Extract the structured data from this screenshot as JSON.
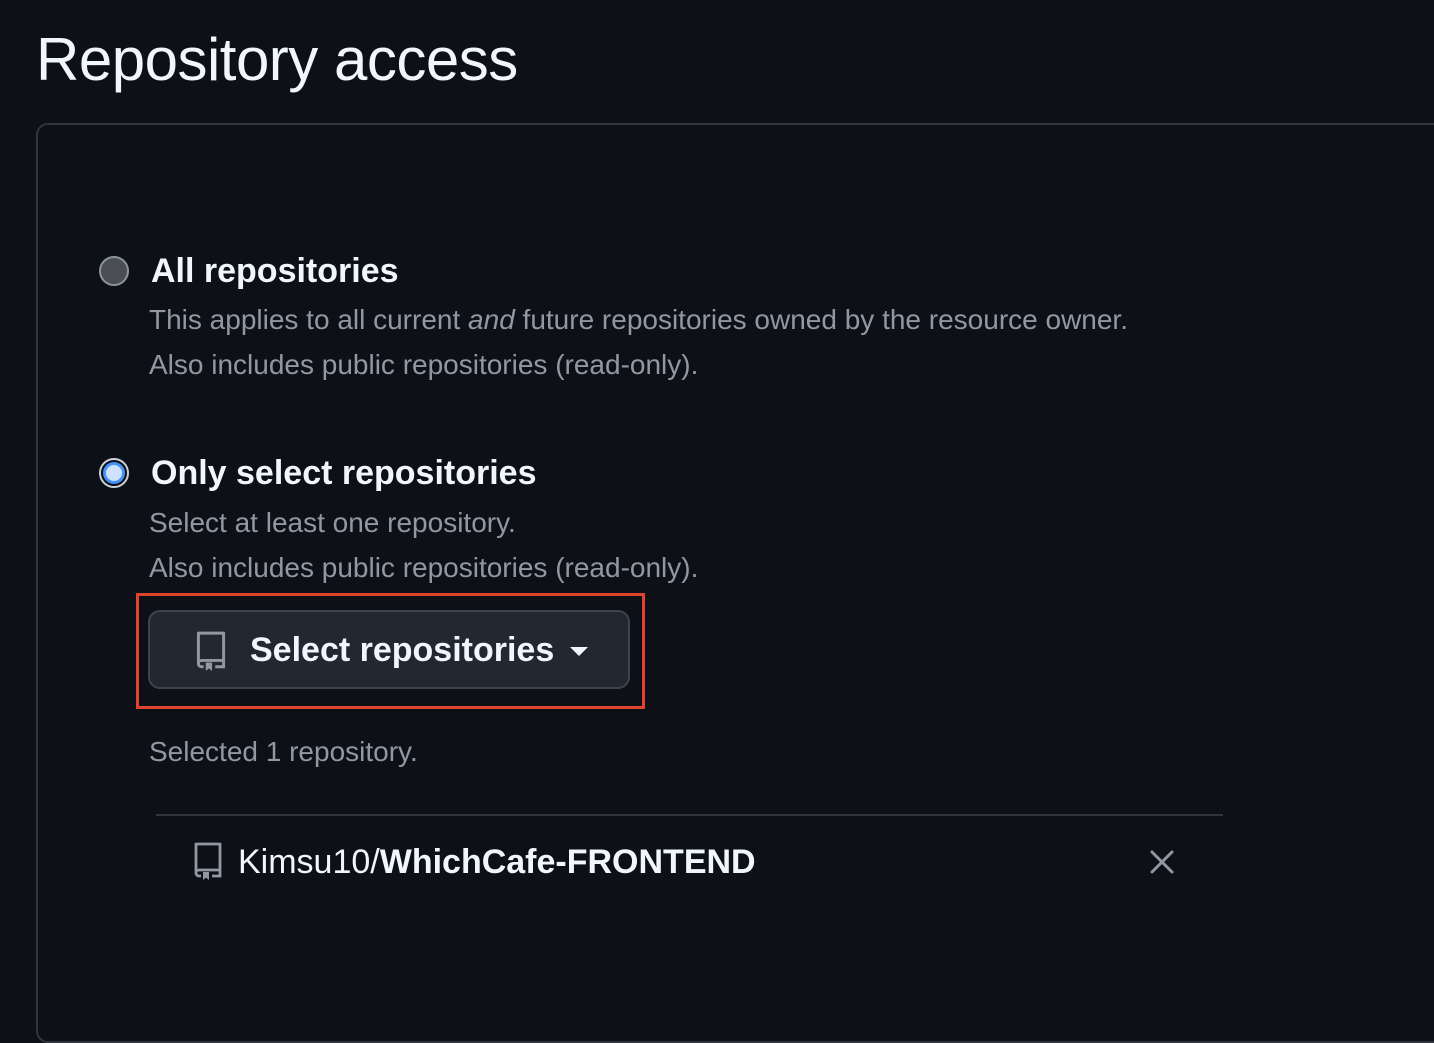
{
  "page": {
    "title": "Repository access"
  },
  "options": {
    "all": {
      "label": "All repositories",
      "desc_pre": "This applies to all current ",
      "desc_em": "and",
      "desc_post": " future repositories owned by the resource owner.",
      "desc_line2": "Also includes public repositories (read-only).",
      "selected": false
    },
    "select": {
      "label": "Only select repositories",
      "desc_line1": "Select at least one repository.",
      "desc_line2": "Also includes public repositories (read-only).",
      "selected": true
    }
  },
  "select_button": {
    "label": "Select repositories",
    "icon": "repo-icon"
  },
  "selected_summary": "Selected 1 repository.",
  "repositories": [
    {
      "owner": "Kimsu10/",
      "name": "WhichCafe-FRONTEND",
      "icon": "repo-icon",
      "remove_icon": "close-icon"
    }
  ],
  "colors": {
    "background": "#0d1117",
    "accent_radio": "#4493f8",
    "highlight_border": "#e0442e",
    "muted_text": "#9198a1"
  }
}
